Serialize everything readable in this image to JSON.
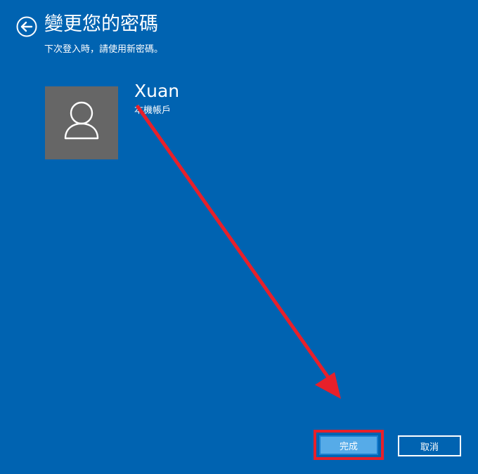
{
  "header": {
    "title": "變更您的密碼",
    "subtitle": "下次登入時，請使用新密碼。",
    "back_icon": "back-arrow-icon"
  },
  "user": {
    "name": "Xuan",
    "account_type": "本機帳戶",
    "avatar_icon": "user-silhouette-icon"
  },
  "buttons": {
    "finish_label": "完成",
    "cancel_label": "取消"
  },
  "annotation": {
    "arrow_color": "#e8202a",
    "highlight_color": "#e8202a"
  },
  "colors": {
    "background": "#0063b1",
    "avatar_bg": "#666666",
    "primary_button": "#56abe8"
  }
}
